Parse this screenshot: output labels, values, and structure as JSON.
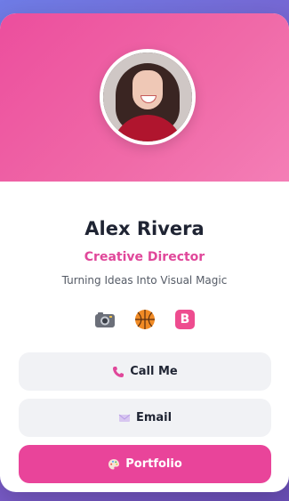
{
  "profile": {
    "name": "Alex Rivera",
    "title": "Creative Director",
    "tagline": "Turning Ideas Into Visual Magic"
  },
  "socials": [
    {
      "icon": "camera-icon"
    },
    {
      "icon": "basketball-icon"
    },
    {
      "icon": "behance-icon",
      "text": "B"
    }
  ],
  "buttons": {
    "call_label": "Call Me",
    "email_label": "Email",
    "portfolio_label": "Portfolio"
  },
  "colors": {
    "accent": "#e9449a",
    "hero_from": "#ec4e9d",
    "hero_to": "#f47eb6",
    "background_from": "#6f7ce6",
    "background_to": "#6a4fb8"
  }
}
